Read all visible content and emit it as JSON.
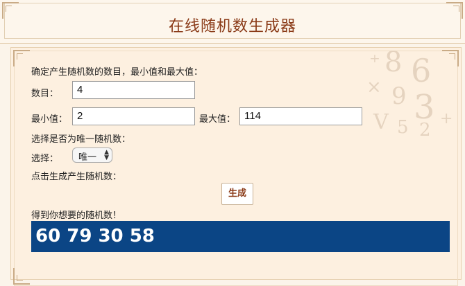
{
  "header": {
    "title": "在线随机数生成器"
  },
  "form": {
    "intro": "确定产生随机数的数目，最小值和最大值：",
    "count_label": "数目：",
    "count_value": "4",
    "min_label": "最小值：",
    "min_value": "2",
    "max_label": "最大值：",
    "max_value": "114",
    "unique_prompt": "选择是否为唯一随机数：",
    "choice_label": "选择：",
    "choice_value": "唯一",
    "generate_prompt": "点击生成产生随机数：",
    "generate_button": "生成",
    "result_label": "得到你想要的随机数！",
    "result_value": "60 79 30 58"
  },
  "colors": {
    "title": "#8a3a17",
    "result_bg": "#0b4585",
    "page_bg": "#fbf4ea"
  }
}
